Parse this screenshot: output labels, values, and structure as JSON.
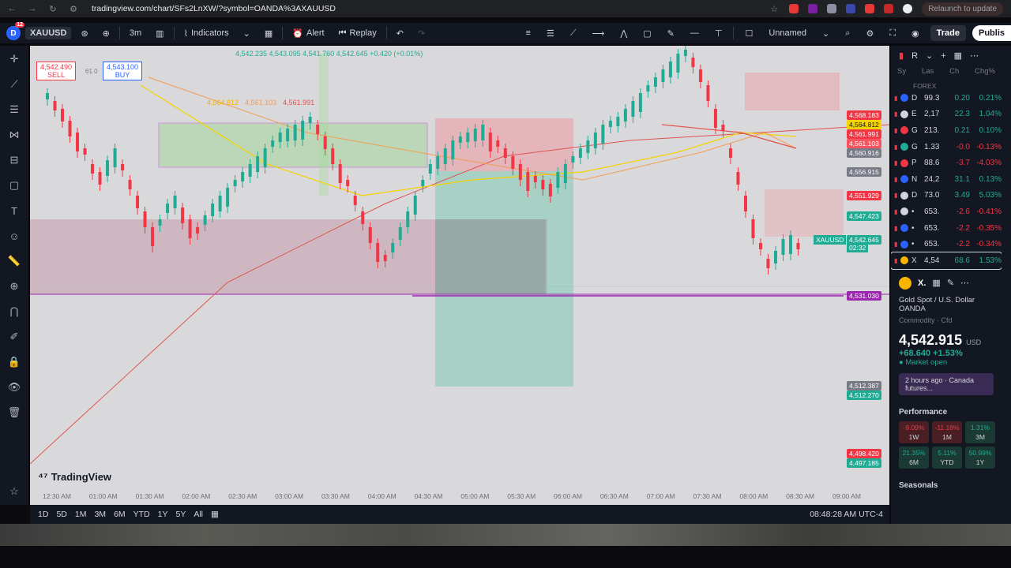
{
  "browser": {
    "url": "tradingview.com/chart/SFs2LnXW/?symbol=OANDA%3AXAUUSD",
    "relaunch": "Relaunch to update"
  },
  "toolbar": {
    "badge": "12",
    "symbol": "XAUUSD",
    "interval": "3m",
    "indicators": "Indicators",
    "alert": "Alert",
    "replay": "Replay",
    "layout_name": "Unnamed",
    "trade": "Trade",
    "publish": "Publis"
  },
  "chart": {
    "sell_price": "4,542.490",
    "sell_label": "SELL",
    "spread": "61.0",
    "buy_price": "4,543.100",
    "buy_label": "BUY",
    "ohlc": "4,542.235   4,543.095   4,541.760   4,542.645  +0.420 (+0.01%)",
    "ma1": "4,564.812",
    "ma2": "4,561.103",
    "ma3": "4,561.991",
    "watermark": "TradingView",
    "price_labels": [
      {
        "v": "4,568.183",
        "color": "#f23645"
      },
      {
        "v": "4,564.812",
        "color": "#f5d300"
      },
      {
        "v": "4,561.991",
        "color": "#f23645"
      },
      {
        "v": "4,561.103",
        "color": "#f7525f"
      },
      {
        "v": "4,560.916",
        "color": "#787b86"
      },
      {
        "v": "4,556.915",
        "color": "#787b86"
      },
      {
        "v": "4,551.929",
        "color": "#f23645"
      },
      {
        "v": "4,547.423",
        "color": "#22ab94"
      },
      {
        "v": "4,542.645",
        "color": "#22ab94"
      },
      {
        "v": "4,531.030",
        "color": "#9c27b0"
      },
      {
        "v": "4,512.387",
        "color": "#787b86"
      },
      {
        "v": "4,512.270",
        "color": "#22ab94"
      },
      {
        "v": "4,498.420",
        "color": "#f23645"
      },
      {
        "v": "4,497.185",
        "color": "#22ab94"
      }
    ],
    "symbol_tag": "XAUUSD",
    "countdown": "02:32",
    "time_ticks": [
      "12:30 AM",
      "01:00 AM",
      "01:30 AM",
      "02:00 AM",
      "02:30 AM",
      "03:00 AM",
      "03:30 AM",
      "04:00 AM",
      "04:30 AM",
      "05:00 AM",
      "05:30 AM",
      "06:00 AM",
      "06:30 AM",
      "07:00 AM",
      "07:30 AM",
      "08:00 AM",
      "08:30 AM",
      "09:00 AM"
    ]
  },
  "timeframes": [
    "1D",
    "5D",
    "1M",
    "3M",
    "6M",
    "YTD",
    "1Y",
    "5Y",
    "All"
  ],
  "clock": "08:48:28 AM UTC-4",
  "watchlist": {
    "header": "R",
    "cols": [
      "Sy",
      "Las",
      "Ch",
      "Chg%"
    ],
    "section": "FOREX",
    "rows": [
      {
        "n": "D",
        "p": "99.3",
        "c": "0.20",
        "pc": "0.21%",
        "dir": "pos",
        "icon": "#2962ff"
      },
      {
        "n": "E",
        "p": "2,17",
        "c": "22.3",
        "pc": "1.04%",
        "dir": "pos",
        "icon": "#d1d4dc"
      },
      {
        "n": "G",
        "p": "213.",
        "c": "0.21",
        "pc": "0.10%",
        "dir": "pos",
        "icon": "#f23645"
      },
      {
        "n": "G",
        "p": "1.33",
        "c": "-0.0",
        "pc": "-0.13%",
        "dir": "neg",
        "icon": "#22ab94"
      },
      {
        "n": "P",
        "p": "88.6",
        "c": "-3.7",
        "pc": "-4.03%",
        "dir": "neg",
        "icon": "#f23645"
      },
      {
        "n": "N",
        "p": "24,2",
        "c": "31.1",
        "pc": "0.13%",
        "dir": "pos",
        "icon": "#2962ff"
      },
      {
        "n": "D",
        "p": "73.0",
        "c": "3.49",
        "pc": "5.03%",
        "dir": "pos",
        "icon": "#d1d4dc"
      },
      {
        "n": "•",
        "p": "653.",
        "c": "-2.6",
        "pc": "-0.41%",
        "dir": "neg",
        "icon": "#d1d4dc"
      },
      {
        "n": "•",
        "p": "653.",
        "c": "-2.2",
        "pc": "-0.35%",
        "dir": "neg",
        "icon": "#2962ff"
      },
      {
        "n": "•",
        "p": "653.",
        "c": "-2.2",
        "pc": "-0.34%",
        "dir": "neg",
        "icon": "#2962ff"
      },
      {
        "n": "X",
        "p": "4,54",
        "c": "68.6",
        "pc": "1.53%",
        "dir": "pos",
        "icon": "#f7b500"
      }
    ]
  },
  "detail": {
    "sym": "X.",
    "name": "Gold Spot / U.S. Dollar",
    "exchange": "OANDA",
    "type": "Commodity · Cfd",
    "price": "4,542.915",
    "ccy": "USD",
    "change": "+68.640  +1.53%",
    "status": "● Market open",
    "news": "2 hours ago · Canada futures...",
    "performance_title": "Performance",
    "performance": [
      {
        "v": "-9.09%",
        "l": "1W",
        "t": "r"
      },
      {
        "v": "-11.18%",
        "l": "1M",
        "t": "r"
      },
      {
        "v": "1.31%",
        "l": "3M",
        "t": "g"
      },
      {
        "v": "21.35%",
        "l": "6M",
        "t": "g"
      },
      {
        "v": "5.11%",
        "l": "YTD",
        "t": "g"
      },
      {
        "v": "50.99%",
        "l": "1Y",
        "t": "g"
      }
    ],
    "seasonals": "Seasonals"
  }
}
